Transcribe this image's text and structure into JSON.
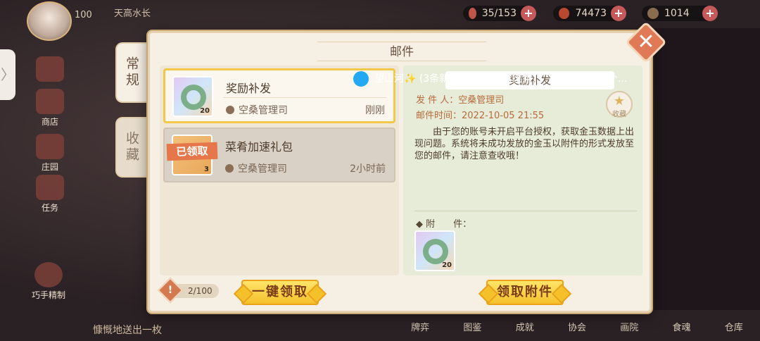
{
  "hud": {
    "level": "100",
    "player_name": "天高水长",
    "resources": [
      {
        "icon": "stamina-icon",
        "value": "35/153"
      },
      {
        "icon": "feather-icon",
        "value": "74473"
      },
      {
        "icon": "coin-icon",
        "value": "1014"
      }
    ],
    "side_icons": [
      {
        "icon": "eye-icon",
        "label": ""
      },
      {
        "icon": "shop-icon",
        "label": "商店"
      },
      {
        "icon": "manor-icon",
        "label": "庄园"
      },
      {
        "icon": "task-icon",
        "label": "任务"
      },
      {
        "icon": "craft-icon",
        "label": "巧手精制"
      }
    ],
    "bottom_nav": [
      "牌弈",
      "图鉴",
      "成就",
      "协会",
      "画院",
      "食魂",
      "仓库"
    ],
    "chat_text": "慷慨地送出一枚",
    "qq_ticker": "望山河✨ (3条新消息) 大茨菇 (废物) ：我方打野还是个..."
  },
  "mail": {
    "title": "邮件",
    "tabs": [
      {
        "label": "常规",
        "active": true
      },
      {
        "label": "收藏",
        "active": false
      }
    ],
    "items": [
      {
        "title": "奖励补发",
        "sender": "空桑管理司",
        "time": "刚刚",
        "qty": "20",
        "selected": true,
        "claimed": false
      },
      {
        "title": "菜肴加速礼包",
        "sender": "空桑管理司",
        "time": "2小时前",
        "qty": "3",
        "selected": false,
        "claimed": true,
        "stamp": "已领取"
      }
    ],
    "detail": {
      "header": "奖励补发",
      "sender_label": "发 件 人：空桑管理司",
      "time_label": "邮件时间：2022-10-05  21:55",
      "favorite_label": "收藏",
      "body": "由于您的账号未开启平台授权，获取金玉数据上出现问题。系统将未成功发放的金玉以附件的形式发放至您的邮件，请注意查收哦！",
      "attachment_label": "◆ 附　　件：",
      "attachment_qty": "20"
    },
    "count": "2/100",
    "claim_all_label": "一键领取",
    "claim_attachment_label": "领取附件"
  }
}
